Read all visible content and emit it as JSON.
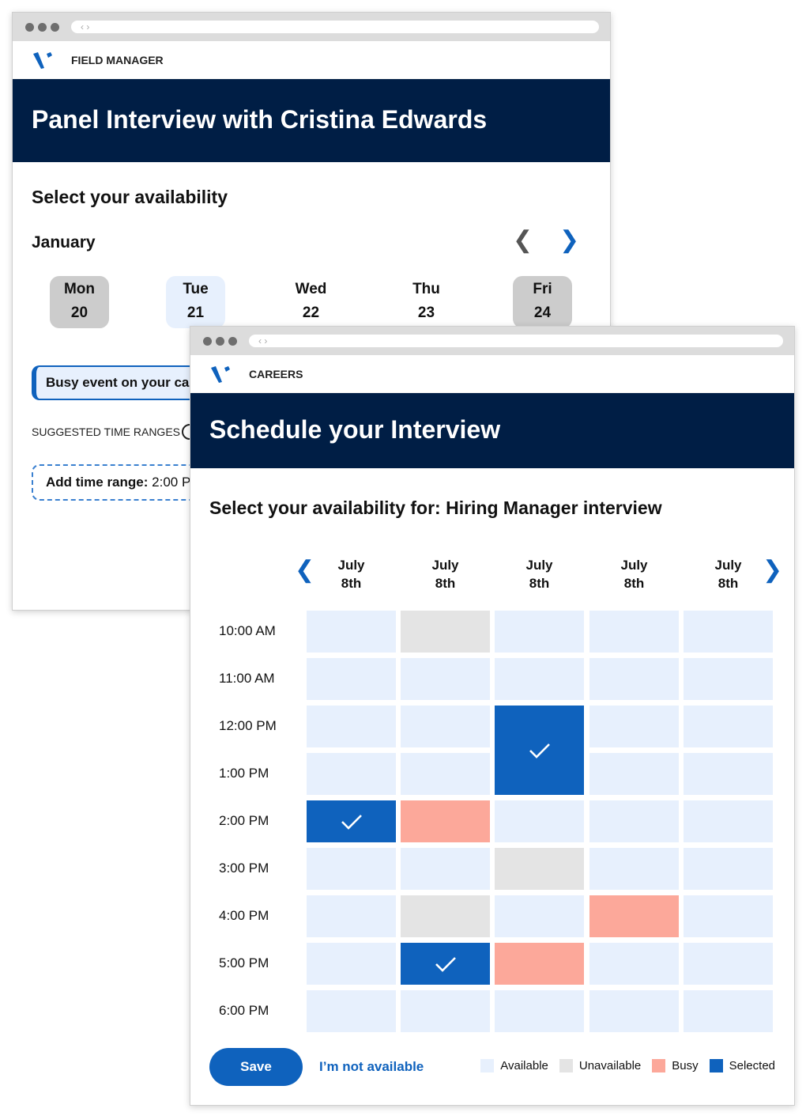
{
  "back_window": {
    "app_name": "FIELD MANAGER",
    "title": "Panel Interview with Cristina Edwards",
    "heading": "Select your availability",
    "month": "January",
    "days": [
      {
        "dow": "Mon",
        "date": "20",
        "state": "unavailable"
      },
      {
        "dow": "Tue",
        "date": "21",
        "state": "active"
      },
      {
        "dow": "Wed",
        "date": "22",
        "state": "none"
      },
      {
        "dow": "Thu",
        "date": "23",
        "state": "none"
      },
      {
        "dow": "Fri",
        "date": "24",
        "state": "unavailable"
      }
    ],
    "busy_event": "Busy event on your calendar",
    "suggested_label": "SUGGESTED TIME RANGES",
    "add_range_label": "Add time range:",
    "add_range_value": "2:00 PM"
  },
  "front_window": {
    "app_name": "CAREERS",
    "title": "Schedule your Interview",
    "heading": "Select your availability for: Hiring Manager interview",
    "columns": [
      {
        "month": "July",
        "day": "8th"
      },
      {
        "month": "July",
        "day": "8th"
      },
      {
        "month": "July",
        "day": "8th"
      },
      {
        "month": "July",
        "day": "8th"
      },
      {
        "month": "July",
        "day": "8th"
      }
    ],
    "times": [
      "10:00 AM",
      "11:00 AM",
      "12:00 PM",
      "1:00 PM",
      "2:00 PM",
      "3:00 PM",
      "4:00 PM",
      "5:00 PM",
      "6:00 PM"
    ],
    "grid": [
      [
        "available",
        "unavailable",
        "available",
        "available",
        "available"
      ],
      [
        "available",
        "available",
        "available",
        "available",
        "available"
      ],
      [
        "available",
        "available",
        "selected",
        "available",
        "available"
      ],
      [
        "available",
        "available",
        "selected",
        "available",
        "available"
      ],
      [
        "selected",
        "busy",
        "available",
        "available",
        "available"
      ],
      [
        "available",
        "available",
        "unavailable",
        "available",
        "available"
      ],
      [
        "available",
        "unavailable",
        "available",
        "busy",
        "available"
      ],
      [
        "available",
        "selected",
        "busy",
        "available",
        "available"
      ],
      [
        "available",
        "available",
        "available",
        "available",
        "available"
      ]
    ],
    "save_label": "Save",
    "not_available_label": "I’m not available",
    "legend": [
      {
        "label": "Available",
        "state": "available"
      },
      {
        "label": "Unavailable",
        "state": "unavailable"
      },
      {
        "label": "Busy",
        "state": "busy"
      },
      {
        "label": "Selected",
        "state": "selected"
      }
    ]
  },
  "colors": {
    "navy": "#001e45",
    "accent": "#0f62bd",
    "available": "#e7f0fd",
    "unavailable": "#e4e4e4",
    "busy": "#fca89a",
    "selected": "#0f62bd",
    "day_gray": "#cccccc",
    "day_active": "#e7f0fd"
  },
  "icons": {
    "logo": "v-logo",
    "prev": "chevron-left-icon",
    "next": "chevron-right-icon",
    "check": "check-icon",
    "info": "info-icon"
  }
}
